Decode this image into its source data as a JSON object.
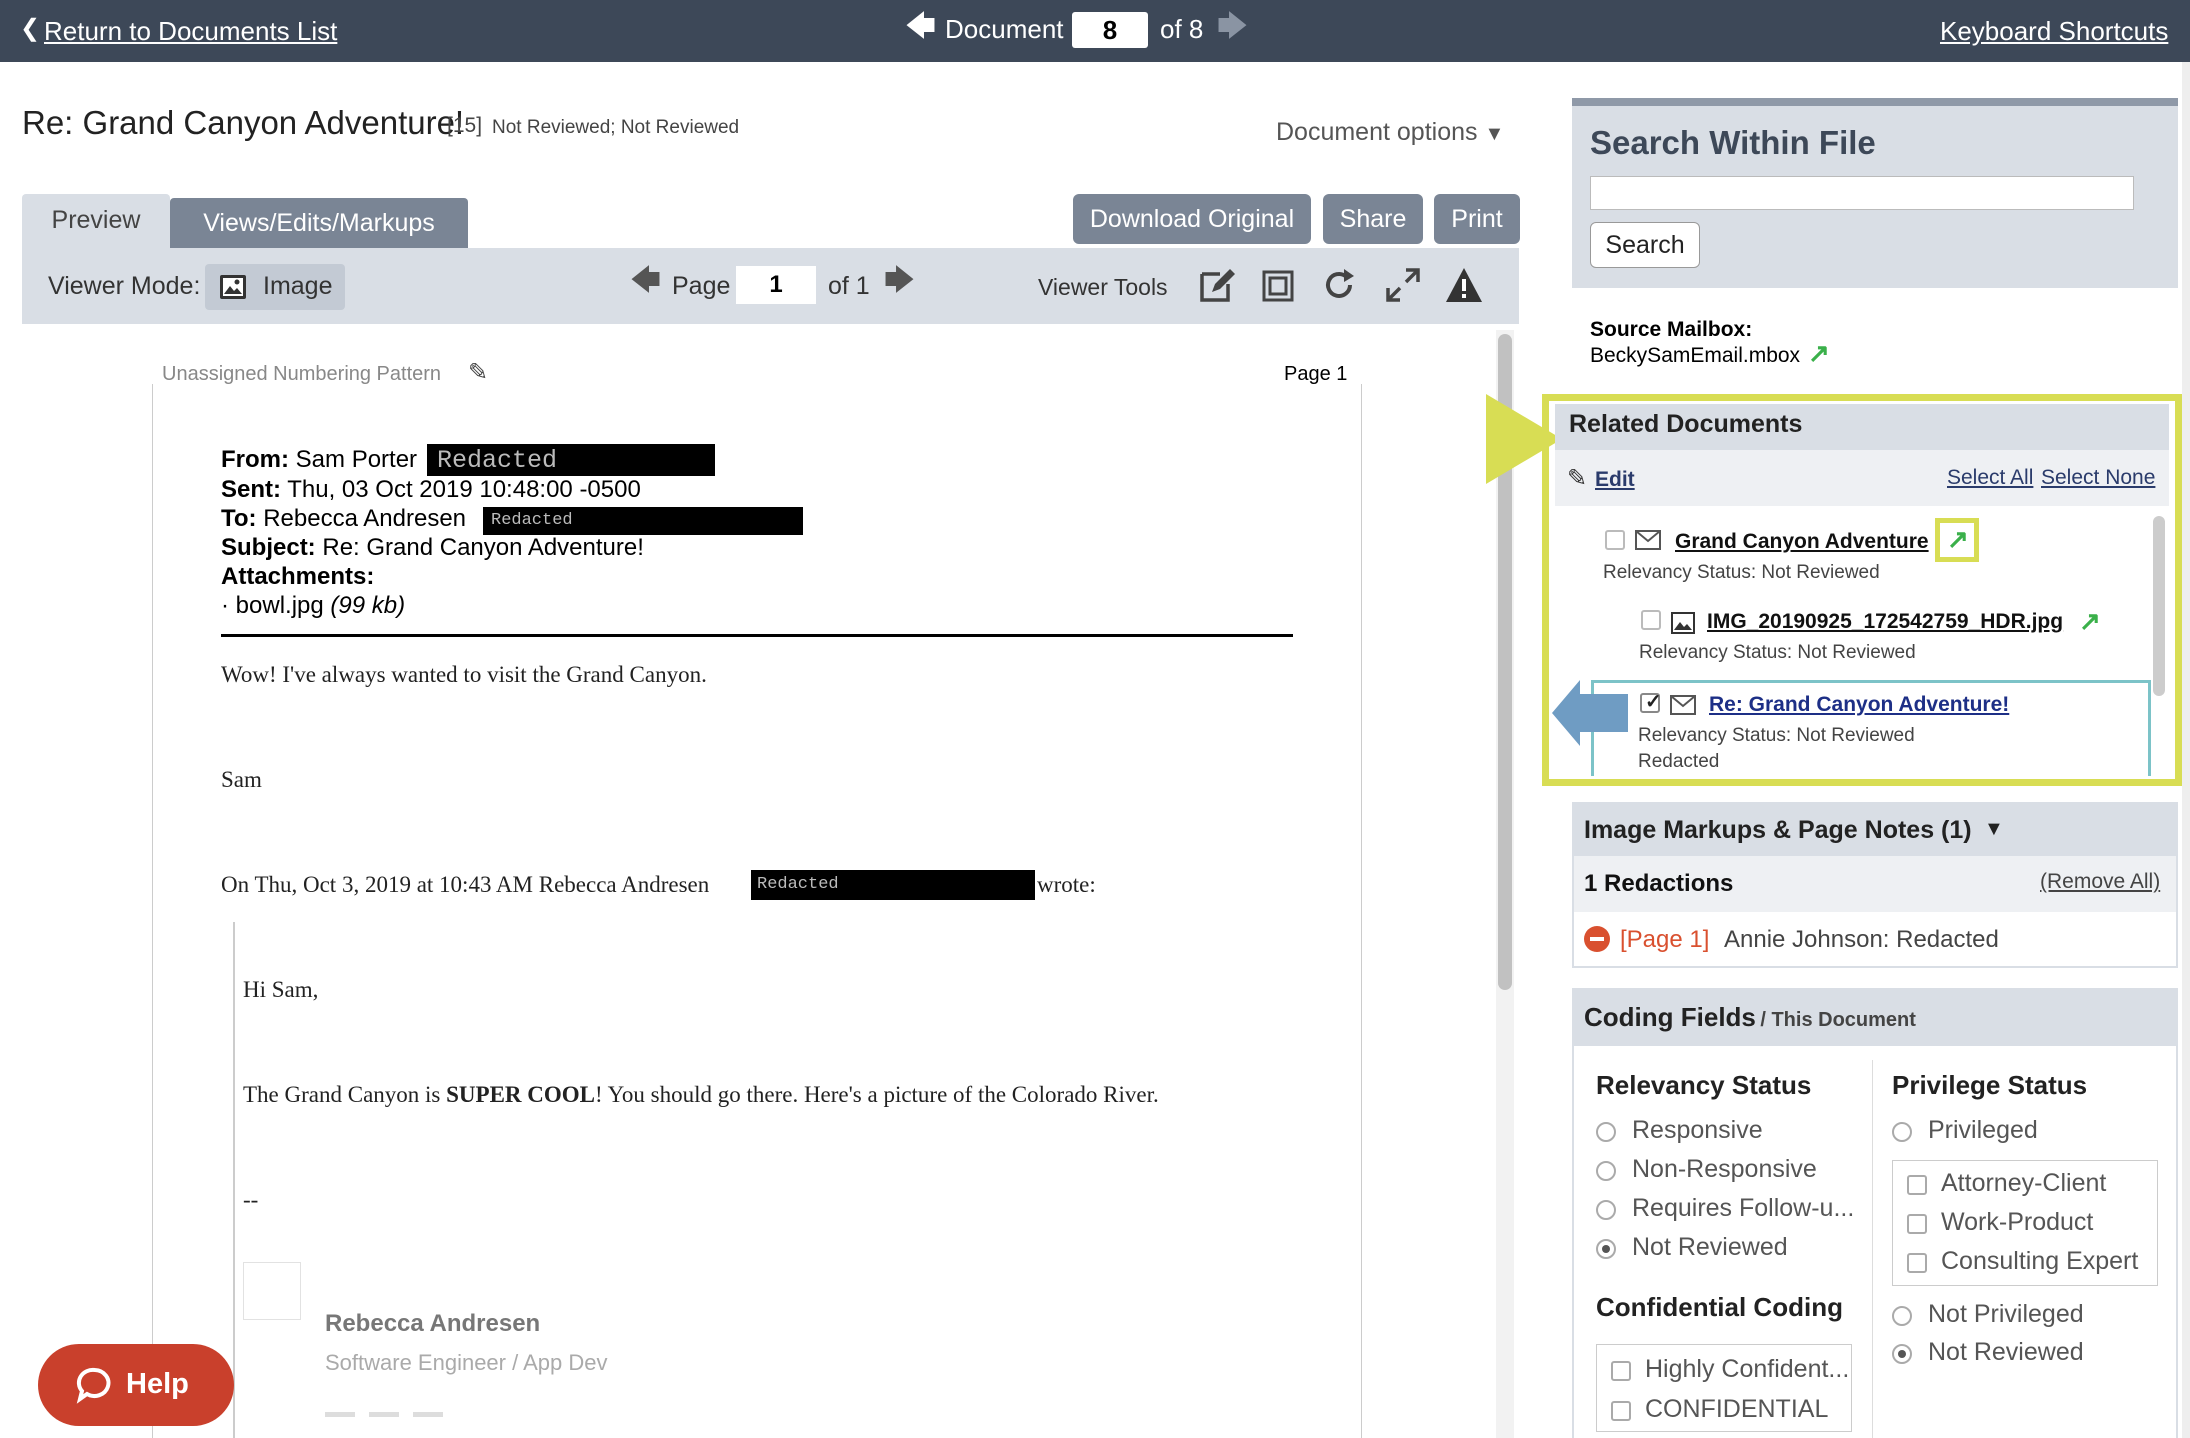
{
  "topbar": {
    "return_link": "Return to Documents List",
    "document_label": "Document",
    "document_number": "8",
    "document_of": "of 8",
    "shortcuts_link": "Keyboard Shortcuts"
  },
  "header": {
    "title": "Re: Grand Canyon Adventure!",
    "count": "[15]",
    "status": "Not Reviewed; Not Reviewed",
    "document_options": "Document options"
  },
  "tabs": [
    {
      "label": "Preview"
    },
    {
      "label": "Views/Edits/Markups"
    }
  ],
  "actions": {
    "download": "Download Original",
    "share": "Share",
    "print": "Print"
  },
  "toolbar": {
    "viewer_mode_label": "Viewer Mode:",
    "viewer_mode_value": "Image",
    "page_label": "Page",
    "page_value": "1",
    "page_of": "of 1",
    "viewer_tools_label": "Viewer Tools"
  },
  "document": {
    "numbering_pattern": "Unassigned Numbering Pattern",
    "page_label": "Page 1",
    "from_label": "From:",
    "from_value": "Sam Porter",
    "sent_label": "Sent:",
    "sent_value": "Thu, 03 Oct 2019 10:48:00 -0500",
    "to_label": "To:",
    "to_value": "Rebecca Andresen",
    "subject_label": "Subject:",
    "subject_value": "Re: Grand Canyon Adventure!",
    "attachments_label": "Attachments:",
    "attachment_name": "· bowl.jpg",
    "attachment_size": "(99 kb)",
    "redacted_text": "Redacted",
    "body_line1": "Wow! I've always wanted to visit the Grand Canyon.",
    "body_sign": "Sam",
    "quote_header_pre": "On Thu, Oct 3, 2019 at 10:43 AM Rebecca Andresen",
    "quote_header_post": "wrote:",
    "quote_greeting": "Hi Sam,",
    "quote_line_pre": "The Grand Canyon is ",
    "quote_line_bold": "SUPER COOL",
    "quote_line_post": "! You should go there. Here's a picture of the Colorado River.",
    "dashes": "--",
    "sig_name": "Rebecca Andresen",
    "sig_title": "Software Engineer / App Dev"
  },
  "help_button": "Help",
  "search": {
    "heading": "Search Within File",
    "input_value": "",
    "button": "Search"
  },
  "source": {
    "label": "Source Mailbox:",
    "value": "BeckySamEmail.mbox"
  },
  "related": {
    "heading": "Related Documents",
    "edit": "Edit",
    "select_all": "Select All",
    "select_none": "Select None",
    "items": [
      {
        "title": "Grand Canyon Adventure",
        "status": "Relevancy Status: Not Reviewed",
        "checked": false
      },
      {
        "title": "IMG_20190925_172542759_HDR.jpg",
        "status": "Relevancy Status: Not Reviewed",
        "checked": false
      },
      {
        "title": "Re: Grand Canyon Adventure!",
        "status": "Relevancy Status: Not Reviewed",
        "extra": "Redacted",
        "checked": true
      }
    ]
  },
  "markups": {
    "heading": "Image Markups & Page Notes (1)",
    "redactions": "1 Redactions",
    "remove_all": "(Remove All)",
    "page_ref": "[Page 1]",
    "entry": "Annie Johnson: Redacted"
  },
  "coding": {
    "heading": "Coding Fields",
    "subheading": "/ This Document",
    "relevancy": {
      "heading": "Relevancy Status",
      "options": [
        "Responsive",
        "Non-Responsive",
        "Requires Follow-u...",
        "Not Reviewed"
      ],
      "selected": "Not Reviewed"
    },
    "privilege": {
      "heading": "Privilege Status",
      "privileged": "Privileged",
      "sub_options": [
        "Attorney-Client",
        "Work-Product",
        "Consulting Expert"
      ],
      "not_privileged": "Not Privileged",
      "not_reviewed": "Not Reviewed",
      "selected": "Not Reviewed"
    },
    "confidential": {
      "heading": "Confidential Coding",
      "options": [
        "Highly Confident...",
        "CONFIDENTIAL"
      ]
    }
  },
  "colors": {
    "topbar": "#3d4858",
    "button": "#7a8595",
    "highlight": "#d8dd54",
    "callout_blue": "#6f9cc3",
    "green_arrow": "#3ab04a",
    "redaction_red": "#d9502f"
  }
}
